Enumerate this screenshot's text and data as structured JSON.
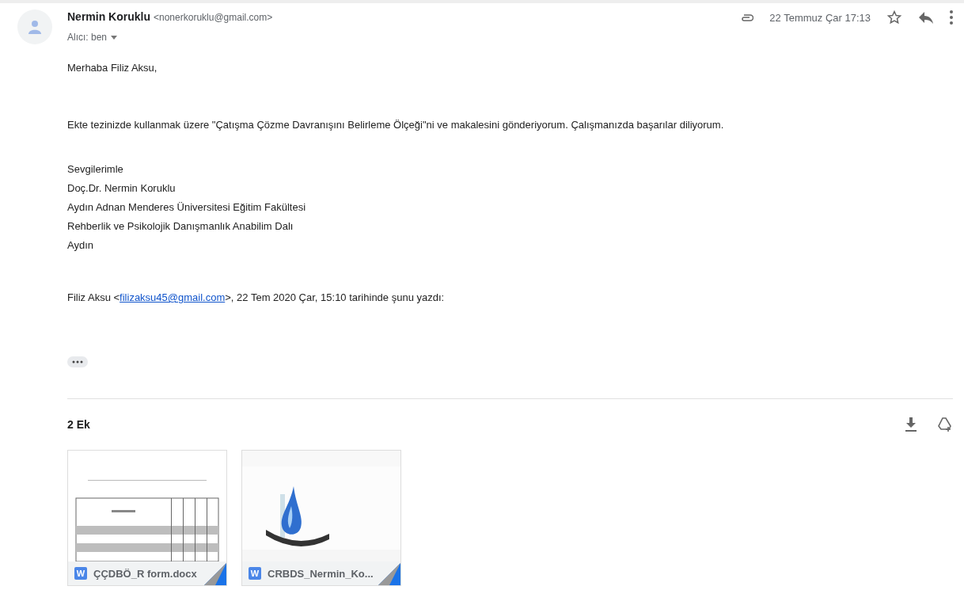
{
  "sender": {
    "name": "Nermin Koruklu",
    "address": "<nonerkoruklu@gmail.com>",
    "recipient": "Alıcı: ben"
  },
  "meta": {
    "date": "22 Temmuz Çar 17:13",
    "starred": false
  },
  "body": [
    "Merhaba Filiz Aksu,",
    "Ekte tezinizde kullanmak üzere \"Çatışma Çözme Davranışını Belirleme Ölçeği\"ni ve makalesini gönderiyorum. Çalışmanızda başarılar diliyorum."
  ],
  "signature": [
    "Sevgilerimle",
    "Doç.Dr. Nermin Koruklu",
    "Aydın Adnan Menderes Üniversitesi Eğitim Fakültesi",
    "Rehberlik ve Psikolojik Danışmanlık Anabilim Dalı",
    "Aydın"
  ],
  "quote_header": {
    "before": "Filiz Aksu <",
    "link": "filizaksu45@gmail.com",
    "after": ">, 22 Tem 2020 Çar, 15:10 tarihinde şunu yazdı:"
  },
  "attachments_title": "2 Ek",
  "attachments": [
    {
      "name": "ÇÇDBÖ_R form.docx",
      "badge": "W",
      "kind": "document"
    },
    {
      "name": "CRBDS_Nermin_Ko...",
      "badge": "W",
      "kind": "logo"
    }
  ]
}
